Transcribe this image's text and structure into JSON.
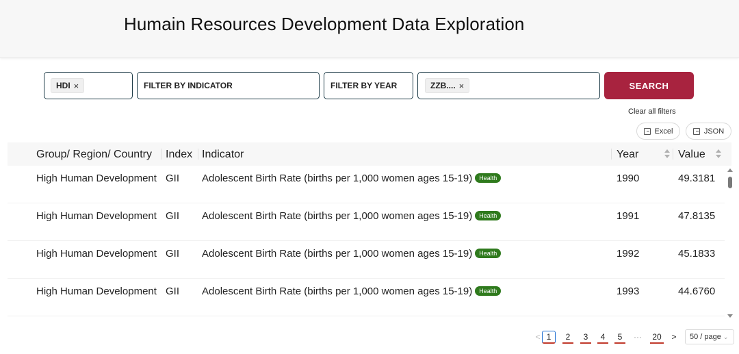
{
  "header": {
    "title": "Humain Resources Development Data Exploration"
  },
  "filters": {
    "group_tag": "HDI",
    "indicator_placeholder": "FILTER BY INDICATOR",
    "year_placeholder": "FILTER BY YEAR",
    "country_tag": "ZZB....",
    "remove_icon": "×"
  },
  "search": {
    "label": "SEARCH"
  },
  "clear_filters": "Clear all filters",
  "export": {
    "excel": "Excel",
    "json": "JSON"
  },
  "table": {
    "columns": [
      "Group/ Region/ Country",
      "Index",
      "Indicator",
      "Year",
      "Value"
    ],
    "rows": [
      {
        "group": "High Human Development",
        "index": "GII",
        "indicator": "Adolescent Birth Rate (births per 1,000 women ages 15-19)",
        "badge": "Health",
        "year": "1990",
        "value": "49.3181"
      },
      {
        "group": "High Human Development",
        "index": "GII",
        "indicator": "Adolescent Birth Rate (births per 1,000 women ages 15-19)",
        "badge": "Health",
        "year": "1991",
        "value": "47.8135"
      },
      {
        "group": "High Human Development",
        "index": "GII",
        "indicator": "Adolescent Birth Rate (births per 1,000 women ages 15-19)",
        "badge": "Health",
        "year": "1992",
        "value": "45.1833"
      },
      {
        "group": "High Human Development",
        "index": "GII",
        "indicator": "Adolescent Birth Rate (births per 1,000 women ages 15-19)",
        "badge": "Health",
        "year": "1993",
        "value": "44.6760"
      }
    ]
  },
  "pagination": {
    "prev": "<",
    "pages": [
      "1",
      "2",
      "3",
      "4",
      "5"
    ],
    "ellipsis": "···",
    "last": "20",
    "next": ">",
    "active_page": "1",
    "per_page": "50 / page"
  },
  "colors": {
    "search_button": "#a8233f",
    "badge": "#2f7a1d",
    "filter_border": "#1d3b47"
  }
}
